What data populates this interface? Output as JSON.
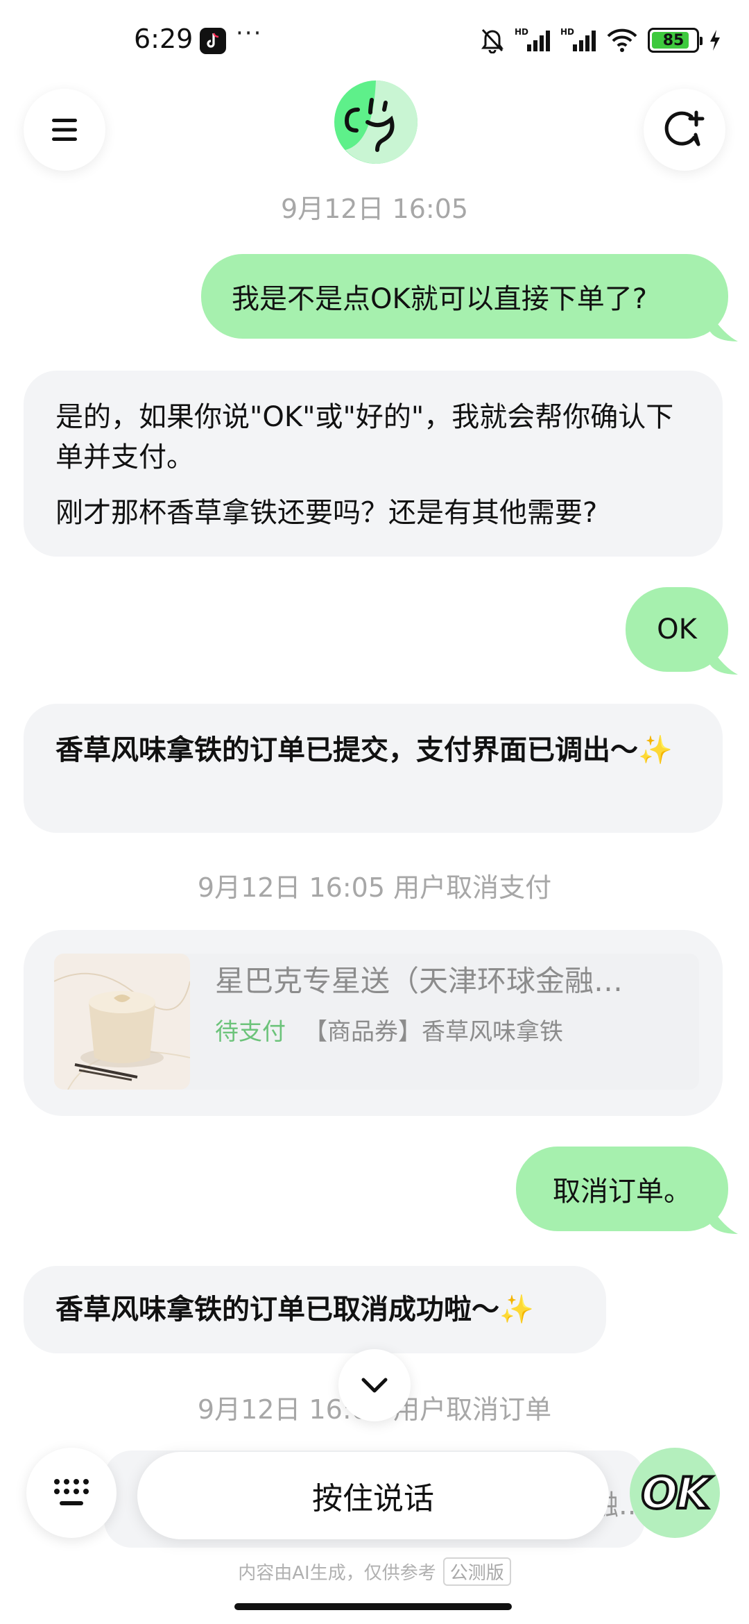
{
  "status_bar": {
    "time": "6:29",
    "more": "···",
    "battery": "85",
    "battery_level": 0.85,
    "icons": [
      "tiktok-icon",
      "mute-icon",
      "signal-hd-icon",
      "signal-hd-icon",
      "wifi-icon",
      "battery-icon",
      "charging-icon"
    ]
  },
  "header": {
    "menu_icon": "menu-icon",
    "new_chat_icon": "new-chat-icon",
    "avatar": "assistant-avatar"
  },
  "messages": {
    "ts1": "9月12日 16:05",
    "user1": "我是不是点OK就可以直接下单了?",
    "ai1_line1": "是的，如果你说\"OK\"或\"好的\"，我就会帮你确认下单并支付。",
    "ai1_line2": "刚才那杯香草拿铁还要吗？还是有其他需要?",
    "user2": "OK",
    "ai2": "香草风味拿铁的订单已提交，支付界面已调出～✨",
    "ts2": "9月12日 16:05 用户取消支付",
    "order": {
      "title": "星巴克专星送（天津环球金融…",
      "status": "待支付",
      "item": "【商品券】香草风味拿铁"
    },
    "user3": "取消订单。",
    "ai3": "香草风味拿铁的订单已取消成功啦～✨",
    "ts3": "9月12日 16:05 用户取消订单",
    "peek": "融.."
  },
  "input_bar": {
    "hold_to_talk": "按住说话",
    "ok_label": "OK",
    "disclaimer": "内容由AI生成，仅供参考",
    "beta": "公测版"
  },
  "colors": {
    "user_bubble": "#a6f0ae",
    "ai_bubble": "#f3f4f6",
    "status_green": "#6cc37a",
    "timestamp": "#a7a7a7"
  }
}
